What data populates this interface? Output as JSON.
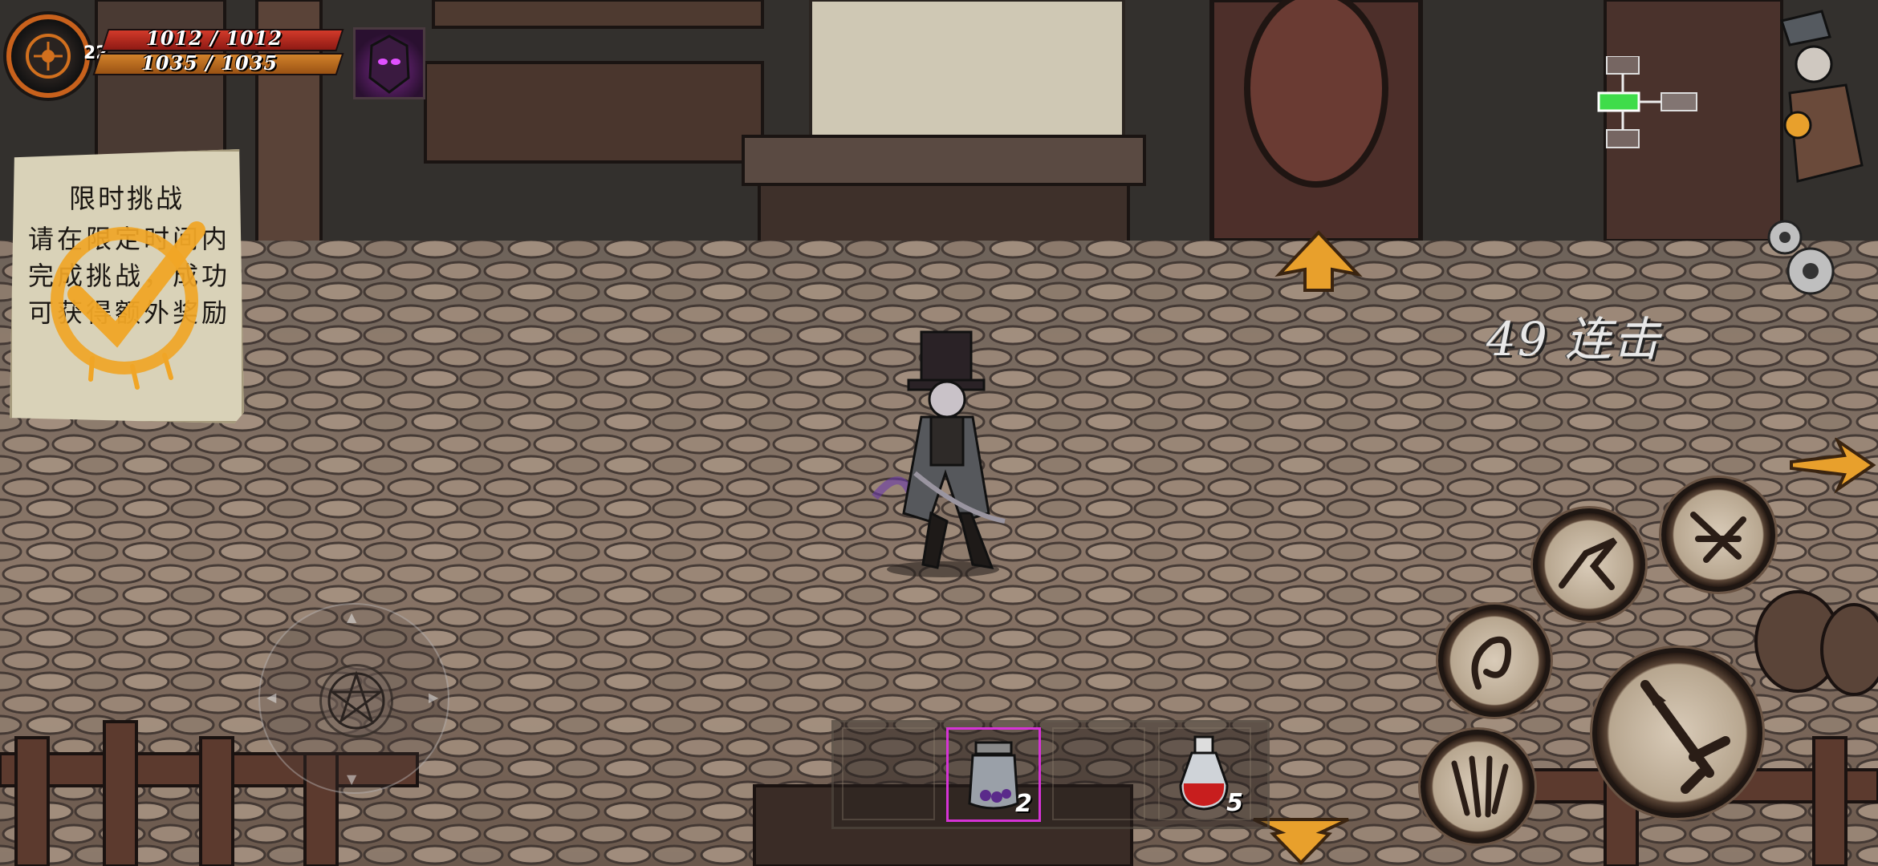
{
  "hud": {
    "level": "22",
    "hp_text": "1012 / 1012",
    "hp_value": 1012,
    "hp_max": 1012,
    "mp_text": "1035 / 1035",
    "mp_value": 1035,
    "mp_max": 1035
  },
  "challenge": {
    "title": "限时挑战",
    "body": "请在限定时间内完成挑战，成功可获得额外奖励",
    "completed": true
  },
  "combo": {
    "text": "49 连击"
  },
  "minimap": {
    "rooms": 4,
    "current_room_color": "#3fdc4a"
  },
  "items": [
    {
      "icon": "empty-slot",
      "count": ""
    },
    {
      "icon": "purple-jar-icon",
      "count": "2",
      "selected": true
    },
    {
      "icon": "empty-slot",
      "count": ""
    },
    {
      "icon": "red-potion-icon",
      "count": "5"
    }
  ],
  "skills": [
    "spin-slash-skill-icon",
    "leap-strike-skill-icon",
    "whirl-skill-icon",
    "claw-skill-icon",
    "sword-attack-icon"
  ],
  "nav_arrows": [
    "up-arrow-icon",
    "right-arrow-icon",
    "down-arrow-icon"
  ],
  "colors": {
    "hp_bar": "#d23a2a",
    "mp_bar": "#d2822a",
    "accent_orange": "#e8a02c",
    "selected_slot": "#d633d6"
  }
}
